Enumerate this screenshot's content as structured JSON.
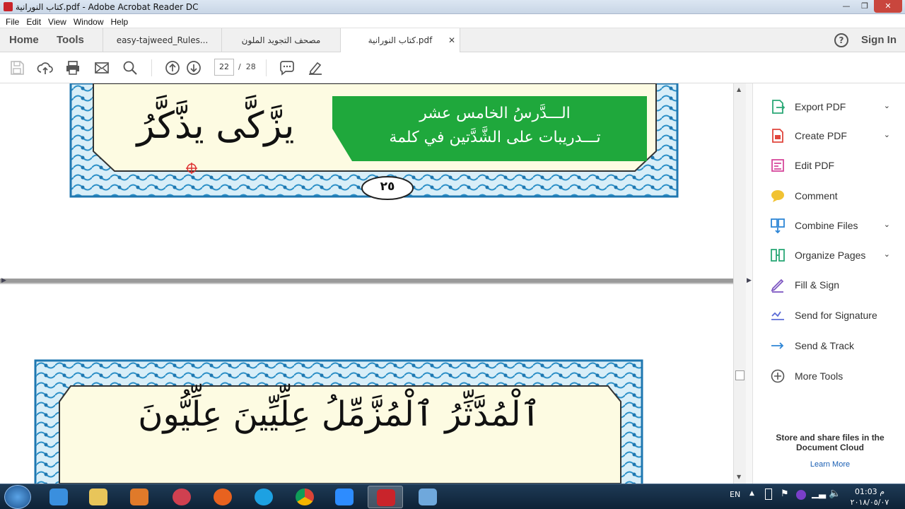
{
  "window": {
    "title": "كتاب النورانية.pdf - Adobe Acrobat Reader DC"
  },
  "menu": [
    "File",
    "Edit",
    "View",
    "Window",
    "Help"
  ],
  "nav": {
    "home": "Home",
    "tools": "Tools",
    "sign_in": "Sign In"
  },
  "tabs": [
    {
      "label": "easy-tajweed_Rules..."
    },
    {
      "label": "مصحف التجويد الملون"
    },
    {
      "label": "كتاب النورانية.pdf"
    }
  ],
  "page_nav": {
    "current": "22",
    "total": "28",
    "separator": "/"
  },
  "document": {
    "page1": {
      "banner_line1": "الـــدَّرسُ الخامس عشر",
      "banner_line2": "تـــدريبات على الشَّدَّتين في كلمة",
      "words": "يزَّكَّى يذَّكَّرُ",
      "page_number": "٢٥"
    },
    "page2": {
      "words": "ٱلْمُدَّثِّرُ ٱلْمُزَّمِّلُ عِلِّيِّينَ عِلِّيُّونَ"
    }
  },
  "tools_panel": {
    "items": [
      {
        "label": "Export PDF",
        "icon": "export-pdf-icon",
        "color": "#2aa876"
      },
      {
        "label": "Create PDF",
        "icon": "create-pdf-icon",
        "color": "#e0453c"
      },
      {
        "label": "Edit PDF",
        "icon": "edit-pdf-icon",
        "color": "#d6479b"
      },
      {
        "label": "Comment",
        "icon": "comment-icon",
        "color": "#f1c232"
      },
      {
        "label": "Combine Files",
        "icon": "combine-files-icon",
        "color": "#2e86d6"
      },
      {
        "label": "Organize Pages",
        "icon": "organize-pages-icon",
        "color": "#2aa876"
      },
      {
        "label": "Fill & Sign",
        "icon": "fill-sign-icon",
        "color": "#7e57c2"
      },
      {
        "label": "Send for Signature",
        "icon": "send-signature-icon",
        "color": "#5b6bd6"
      },
      {
        "label": "Send & Track",
        "icon": "send-track-icon",
        "color": "#2e86d6"
      },
      {
        "label": "More Tools",
        "icon": "more-tools-icon",
        "color": "#555555"
      }
    ],
    "store_text": "Store and share files in the Document Cloud",
    "learn_more": "Learn More"
  },
  "taskbar": {
    "lang": "EN",
    "time": "01:03 م",
    "date": "٢٠١٨/٠٥/٠٧"
  }
}
